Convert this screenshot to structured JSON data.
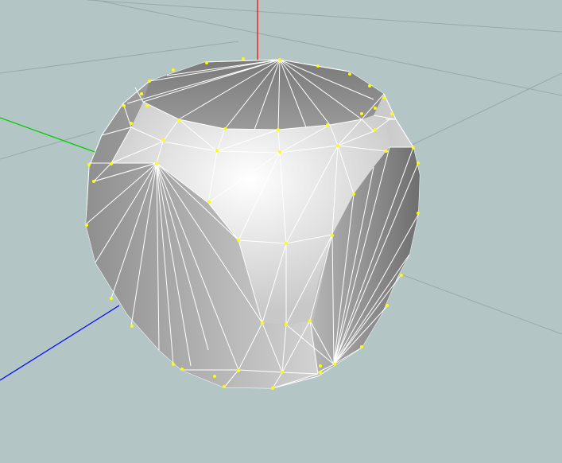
{
  "viewport": {
    "background": "#b4c5c5",
    "grid_color": "#9aa9a9"
  },
  "axes": {
    "x_color": "#ff0000",
    "y_color": "#00cc00",
    "z_color": "#0000ff"
  },
  "mesh": {
    "face_colors": {
      "light": "#f0f0f0",
      "mid": "#c9c9c9",
      "dark": "#8a8a8a",
      "darker": "#707070"
    },
    "edge_color": "#ffffff",
    "vertex_color": "#ffff00"
  }
}
